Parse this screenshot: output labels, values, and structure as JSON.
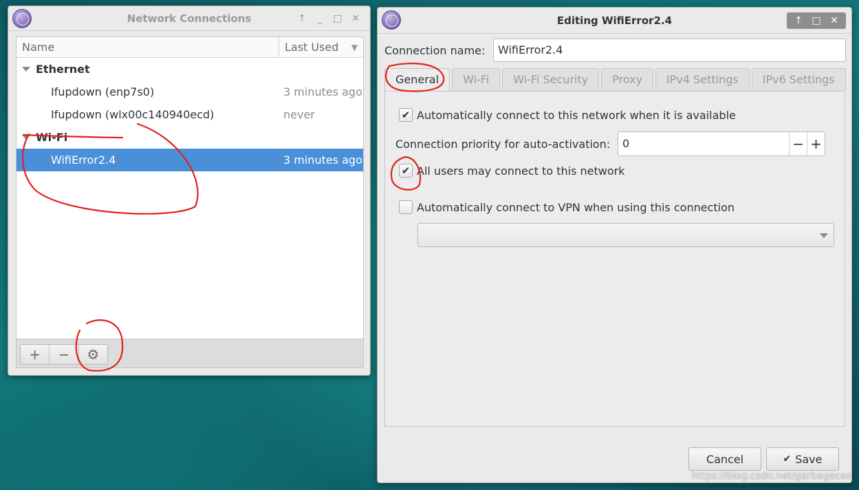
{
  "network_connections": {
    "title": "Network Connections",
    "columns": {
      "name": "Name",
      "last_used": "Last Used"
    },
    "groups": [
      {
        "name": "Ethernet",
        "connections": [
          {
            "name": "Ifupdown (enp7s0)",
            "last_used": "3 minutes ago"
          },
          {
            "name": "Ifupdown (wlx00c140940ecd)",
            "last_used": "never"
          }
        ]
      },
      {
        "name": "Wi-Fi",
        "connections": [
          {
            "name": "WifiError2.4",
            "last_used": "3 minutes ago",
            "selected": true
          }
        ]
      }
    ],
    "toolbar": {
      "add": "+",
      "remove": "−",
      "settings": "⚙"
    }
  },
  "editor": {
    "title": "Editing WifiError2.4",
    "connection_name_label": "Connection name:",
    "connection_name_value": "WifiError2.4",
    "tabs": [
      {
        "label": "General",
        "active": true
      },
      {
        "label": "Wi-Fi"
      },
      {
        "label": "Wi-Fi Security"
      },
      {
        "label": "Proxy"
      },
      {
        "label": "IPv4 Settings"
      },
      {
        "label": "IPv6 Settings"
      }
    ],
    "general": {
      "auto_connect_label": "Automatically connect to this network when it is available",
      "auto_connect_checked": true,
      "priority_label": "Connection priority for auto-activation:",
      "priority_value": "0",
      "all_users_label": "All users may connect to this network",
      "all_users_checked": true,
      "vpn_label": "Automatically connect to VPN when using this connection",
      "vpn_checked": false,
      "vpn_selected": ""
    },
    "buttons": {
      "cancel": "Cancel",
      "save": "Save"
    }
  },
  "watermark": "https://blog.csdn.net/garbageceo",
  "colors": {
    "selection": "#4a90d9",
    "annotation": "#e0201b"
  }
}
